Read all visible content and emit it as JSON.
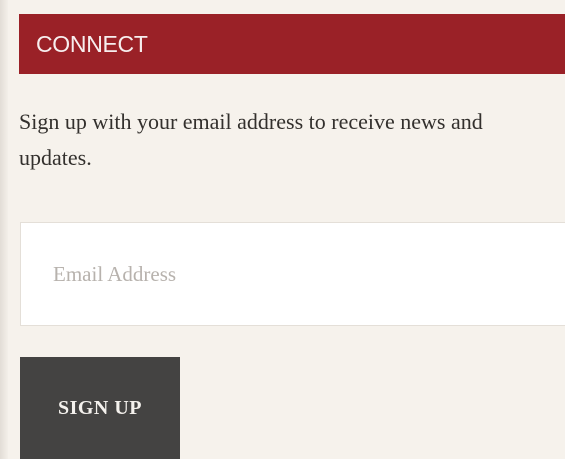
{
  "connect": {
    "title": "CONNECT",
    "description": "Sign up with your email address to receive news and updates.",
    "email_placeholder": "Email Address",
    "email_value": "",
    "signup_label": "SIGN UP"
  },
  "colors": {
    "header_background": "#9a2127",
    "page_background": "#f6f2ec",
    "button_background": "#444342"
  }
}
